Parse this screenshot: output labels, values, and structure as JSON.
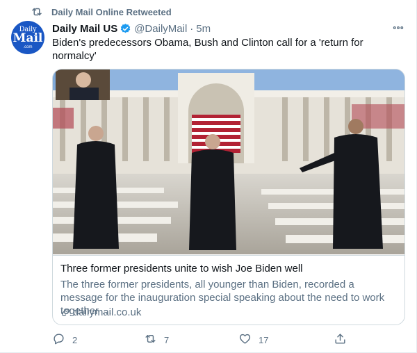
{
  "retweet_label": "Daily Mail Online Retweeted",
  "avatar": {
    "line1": "Daily",
    "line2": "Mail",
    "line3": ".com"
  },
  "author": {
    "name": "Daily Mail US",
    "handle": "@DailyMail",
    "separator": "·",
    "time": "5m"
  },
  "tweet_text": "Biden's predecessors Obama, Bush and Clinton call for a 'return for normalcy'",
  "card": {
    "title": "Three former presidents unite to wish Joe Biden well",
    "description": "The three former presidents, all younger than Biden, recorded a message for the inauguration special speaking about the need to work together …",
    "domain": "dailymail.co.uk"
  },
  "actions": {
    "replies": "2",
    "retweets": "7",
    "likes": "17"
  },
  "colors": {
    "accent": "#1d9bf0",
    "secondary_text": "#5b7083",
    "border": "#cfd9de",
    "avatar_bg": "#1a57c4"
  },
  "icons": {
    "retweet": "retweet-icon",
    "verified": "verified-badge-icon",
    "more": "more-icon",
    "link": "link-icon",
    "reply": "reply-icon",
    "like": "heart-icon",
    "share": "share-icon"
  }
}
